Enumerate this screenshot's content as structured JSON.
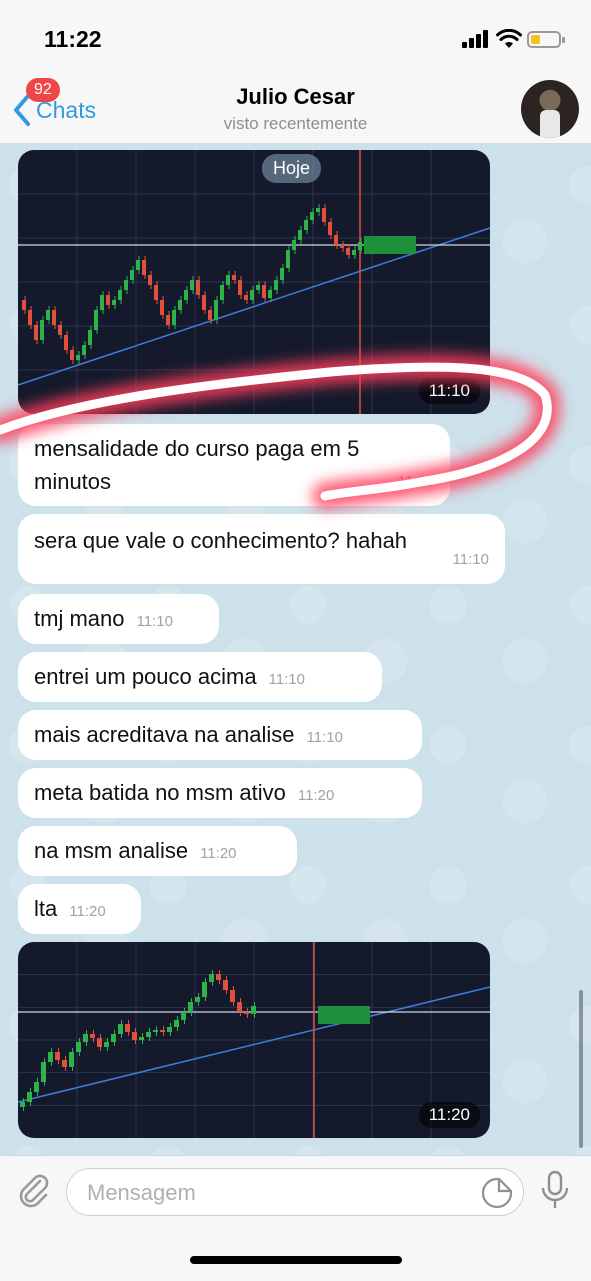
{
  "status_bar": {
    "time": "11:22"
  },
  "header": {
    "back_label": "Chats",
    "unread_badge": "92",
    "title": "Julio Cesar",
    "subtitle": "visto recentemente"
  },
  "date_chip": "Hoje",
  "messages": [
    {
      "type": "image",
      "time": "11:10"
    },
    {
      "type": "text",
      "text": "mensalidade do curso paga em 5 minutos",
      "time": "11:10"
    },
    {
      "type": "text",
      "text": "sera que vale o conhecimento? hahah",
      "time": "11:10"
    },
    {
      "type": "text",
      "text": "tmj mano",
      "time": "11:10"
    },
    {
      "type": "text",
      "text": "entrei um pouco acima",
      "time": "11:10"
    },
    {
      "type": "text",
      "text": "mais acreditava na analise",
      "time": "11:10"
    },
    {
      "type": "text",
      "text": "meta batida no msm ativo",
      "time": "11:20"
    },
    {
      "type": "text",
      "text": "na msm analise",
      "time": "11:20"
    },
    {
      "type": "text",
      "text": "lta",
      "time": "11:20"
    },
    {
      "type": "image",
      "time": "11:20"
    }
  ],
  "composer": {
    "placeholder": "Mensagem"
  },
  "icons": [
    "signal-icon",
    "wifi-icon",
    "battery-icon",
    "chevron-left-icon",
    "avatar",
    "paperclip-icon",
    "sticker-icon",
    "microphone-icon"
  ],
  "colors": {
    "accent": "#2e9be0",
    "badge": "#ef4747",
    "bubble": "#ffffff",
    "wallpaper": "#cde1eb",
    "candle_up": "#2db34a",
    "candle_down": "#e0503c"
  }
}
